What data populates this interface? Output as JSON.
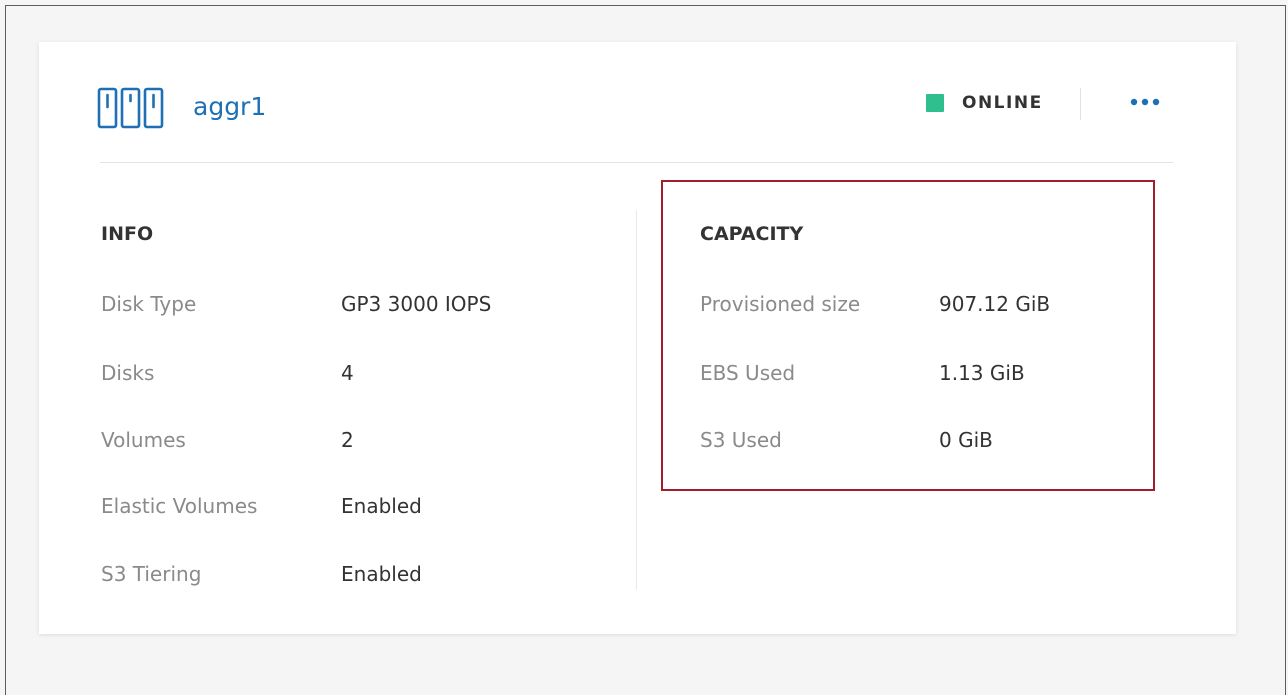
{
  "aggregate": {
    "name": "aggr1",
    "icon": "aggregate-icon",
    "accent_color": "#1f6fb5"
  },
  "status": {
    "label": "ONLINE",
    "color": "#2fbf8f"
  },
  "menu": {
    "icon": "more-horizontal-icon"
  },
  "info": {
    "title": "INFO",
    "rows": [
      {
        "label": "Disk Type",
        "value": "GP3 3000 IOPS"
      },
      {
        "label": "Disks",
        "value": "4"
      },
      {
        "label": "Volumes",
        "value": "2"
      },
      {
        "label": "Elastic Volumes",
        "value": "Enabled"
      },
      {
        "label": "S3 Tiering",
        "value": "Enabled"
      }
    ]
  },
  "capacity": {
    "title": "CAPACITY",
    "highlight_color": "#a21d2a",
    "rows": [
      {
        "label": "Provisioned size",
        "value": "907.12 GiB"
      },
      {
        "label": "EBS Used",
        "value": "1.13 GiB"
      },
      {
        "label": "S3 Used",
        "value": "0 GiB"
      }
    ]
  }
}
